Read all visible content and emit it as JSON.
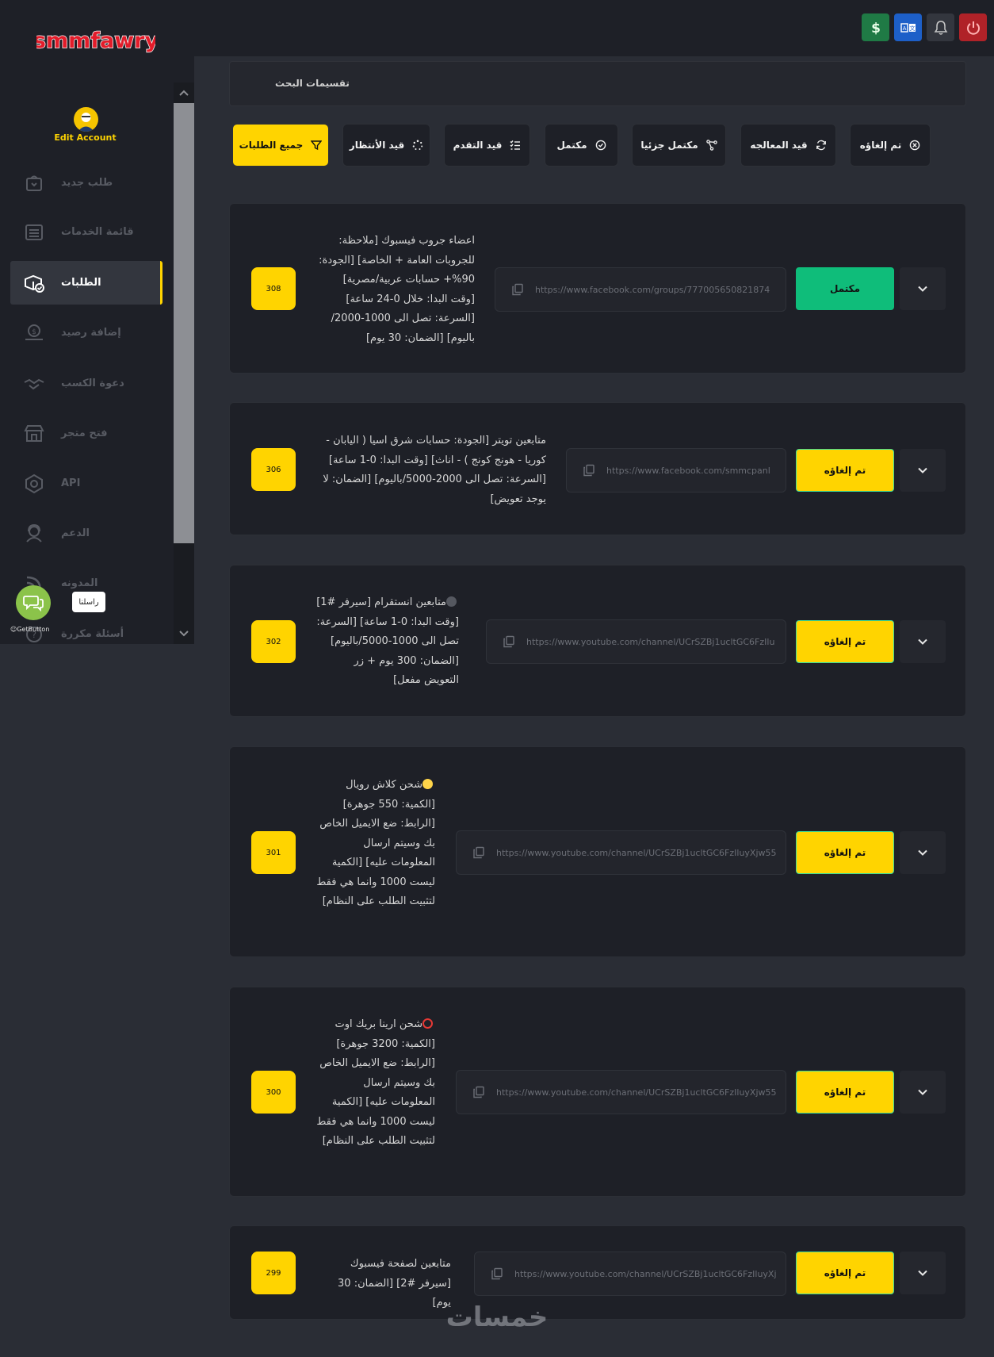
{
  "brand": {
    "logo_text": "smmfawry",
    "edit_account": "Edit Account"
  },
  "topbar": {
    "icons": [
      "dollar-icon",
      "translate-icon",
      "bell-icon",
      "power-icon"
    ]
  },
  "sidebar": {
    "items": [
      {
        "label": "طلب جديد",
        "icon": "shopping-bag-icon"
      },
      {
        "label": "قائمة الخدمات",
        "icon": "list-icon"
      },
      {
        "label": "الطلبات",
        "icon": "orders-icon",
        "active": true
      },
      {
        "label": "إضافة رصيد",
        "icon": "wallet-icon"
      },
      {
        "label": "دعوة الكسب",
        "icon": "handshake-icon"
      },
      {
        "label": "فتح متجر",
        "icon": "store-icon"
      },
      {
        "label": "API",
        "icon": "api-icon"
      },
      {
        "label": "الدعم",
        "icon": "support-icon"
      },
      {
        "label": "المدونه",
        "icon": "rss-icon"
      },
      {
        "label": "أسئلة مكررة",
        "icon": "faq-icon"
      }
    ],
    "chat_tooltip": "راسلنا",
    "getbutton_label": "GetButton"
  },
  "search": {
    "title": "تقسيمات البحث"
  },
  "filters": [
    {
      "label": "جميع الطلبات",
      "icon": "filter-icon",
      "active": true
    },
    {
      "label": "قيد الأنتظار",
      "icon": "spinner-icon"
    },
    {
      "label": "قيد التقدم",
      "icon": "tasks-icon"
    },
    {
      "label": "مكتمل",
      "icon": "check-circle-icon"
    },
    {
      "label": "مكتمل جزئيا",
      "icon": "share-nodes-icon"
    },
    {
      "label": "قيد المعالجه",
      "icon": "refresh-icon"
    },
    {
      "label": "تم إلغاؤه",
      "icon": "x-circle-icon"
    }
  ],
  "orders": [
    {
      "id": "308",
      "description": "اعضاء جروب فيسبوك [ملاحظة: للجروبات العامة + الخاصة] [الجودة: 90%+ حسابات عربية/مصرية] [وقت البدا: خلال 0-24 ساعة] [السرعة: تصل الى 1000-2000/باليوم] [الضمان: 30 يوم]",
      "link": "https://www.facebook.com/groups/777005650821874",
      "status": "مكتمل",
      "status_type": "done"
    },
    {
      "id": "306",
      "description": "متابعين تويتر [الجودة: حسابات شرق اسيا ( اليابان - كوريا - هونج كونج ) - اناث] [وقت البدا: 0-1 ساعة] [السرعة: تصل الى 2000-5000/باليوم] [الضمان: لا يوجد تعويض]",
      "link": "https://www.facebook.com/smmcpanl",
      "status": "تم إلغاؤه",
      "status_type": "cancel"
    },
    {
      "id": "302",
      "description": "متابعين انستقرام [سيرفر #1] [وقت البدا: 0-1 ساعة] [السرعة: تصل الى 1000-5000/باليوم] [الضمان: 300 يوم + زر التعويض مفعل]",
      "link": "https://www.youtube.com/channel/UCrSZBj1ucltGC6FzIlu",
      "status": "تم إلغاؤه",
      "status_type": "cancel",
      "marker": "gray"
    },
    {
      "id": "301",
      "description": "شحن كلاش رويال [الكمية: 550 جوهرة] [الرابط: ضع الايميل الخاص بك وسيتم ارسال المعلومات عليه] [الكمية ليست 1000 وانما هي فقط لتثبيت الطلب على النظام]",
      "link": "https://www.youtube.com/channel/UCrSZBj1ucltGC6FzIluyXjw55",
      "status": "تم إلغاؤه",
      "status_type": "cancel",
      "marker": "yellow"
    },
    {
      "id": "300",
      "description": "شحن ارينا بريك اوت [الكمية: 3200 جوهرة] [الرابط: ضع الايميل الخاص بك وسيتم ارسال المعلومات عليه] [الكمية ليست 1000 وانما هي فقط لتثبيت الطلب على النظام]",
      "link": "https://www.youtube.com/channel/UCrSZBj1ucltGC6FzIluyXjw55",
      "status": "تم إلغاؤه",
      "status_type": "cancel",
      "marker": "red-ring"
    },
    {
      "id": "299",
      "description": "متابعين لصفحة فيسبوك [سيرفر #2] [الضمان: 30 يوم]",
      "link": "https://www.youtube.com/channel/UCrSZBj1ucltGC6FzIluyXj",
      "status": "تم إلغاؤه",
      "status_type": "cancel"
    }
  ],
  "watermark": "خمسات"
}
